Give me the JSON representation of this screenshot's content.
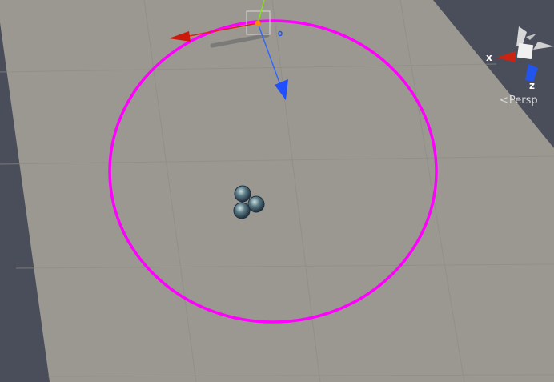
{
  "scene_view": {
    "background_color": "#4a4e5a",
    "ground_color": "#9a9890",
    "grid_color": "#8b8982",
    "circle_color": "#ff00ff",
    "selected_object": {
      "icon": "move-tool-gizmo"
    },
    "center_object": {
      "icon": "sphere-cluster-icon"
    }
  },
  "orientation_gizmo": {
    "x_label": "x",
    "z_label": "z",
    "x_color": "#cc2211",
    "z_color": "#2255ee",
    "neutral_color": "#e0e0e0"
  },
  "view_mode": {
    "arrow": "<",
    "label": "Persp"
  }
}
